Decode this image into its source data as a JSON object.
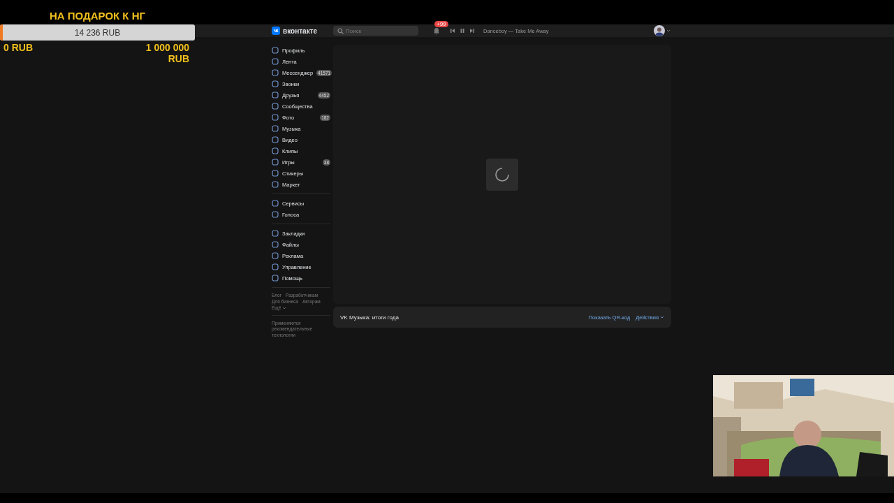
{
  "donation_goal": {
    "title": "НА ПОДАРОК К НГ",
    "amount": "14 236 RUB",
    "level": 0.014,
    "min": "0 RUB",
    "max": "1 000 000 RUB"
  },
  "header": {
    "logo": "вконтакте",
    "search": {
      "placeholder": "Поиск"
    },
    "notifications_badge": "+99",
    "track": "Danceboy — Take Me Away"
  },
  "sidebar": {
    "groups": [
      [
        {
          "label": "Профиль"
        },
        {
          "label": "Лента"
        },
        {
          "label": "Мессенджер",
          "badge": "41571"
        },
        {
          "label": "Звонки"
        },
        {
          "label": "Друзья",
          "badge": "4452"
        },
        {
          "label": "Сообщества"
        },
        {
          "label": "Фото",
          "badge": "182"
        },
        {
          "label": "Музыка"
        },
        {
          "label": "Видео"
        },
        {
          "label": "Клипы"
        },
        {
          "label": "Игры",
          "badge": "38"
        },
        {
          "label": "Стикеры"
        },
        {
          "label": "Маркет"
        }
      ],
      [
        {
          "label": "Сервисы"
        },
        {
          "label": "Голоса"
        }
      ],
      [
        {
          "label": "Закладки"
        },
        {
          "label": "Файлы"
        },
        {
          "label": "Реклама"
        },
        {
          "label": "Управление"
        },
        {
          "label": "Помощь"
        }
      ]
    ],
    "footer_links": [
      "Блог",
      "Разработчикам",
      "Для бизнеса",
      "Авторам",
      "Ещё"
    ],
    "note": "Применяются рекомендательные технологии"
  },
  "content": {
    "loading": true,
    "footer": {
      "title": "VK Музыка: итоги года",
      "actions": [
        "Показать QR-код",
        "Действия"
      ]
    }
  }
}
